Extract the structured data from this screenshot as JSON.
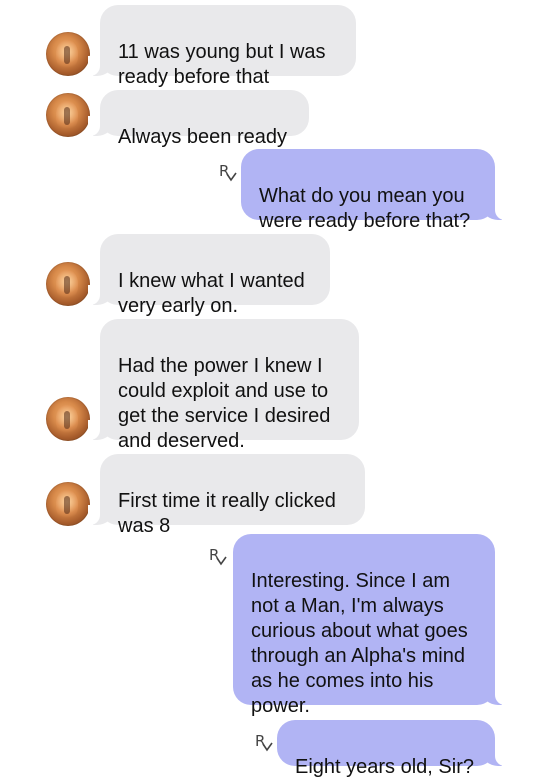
{
  "messages": [
    {
      "direction": "incoming",
      "text": "11 was young but I was\nready before that",
      "avatar": "contact-avatar"
    },
    {
      "direction": "incoming",
      "text": "Always been ready",
      "avatar": "contact-avatar"
    },
    {
      "direction": "outgoing",
      "text": "What do you mean you\nwere ready before that?",
      "receipt_icon": "rx-icon"
    },
    {
      "direction": "incoming",
      "text": "I knew what I wanted\nvery early on.",
      "avatar": "contact-avatar"
    },
    {
      "direction": "incoming",
      "text": "Had the power I knew I\ncould exploit and use to\nget the service I desired\nand deserved.",
      "avatar": "contact-avatar"
    },
    {
      "direction": "incoming",
      "text": "First time it really clicked\nwas 8",
      "avatar": "contact-avatar"
    },
    {
      "direction": "outgoing",
      "text": "Interesting. Since I am\nnot a Man, I'm always\ncurious about what goes\nthrough an Alpha's mind\nas he comes into his\npower.",
      "receipt_icon": "rx-icon"
    },
    {
      "direction": "outgoing",
      "text": "Eight years old, Sir?",
      "receipt_icon": "rx-icon"
    }
  ],
  "colors": {
    "incoming_bubble": "#e9e9eb",
    "outgoing_bubble": "#b1b4f4",
    "text": "#111111",
    "background": "#ffffff"
  }
}
